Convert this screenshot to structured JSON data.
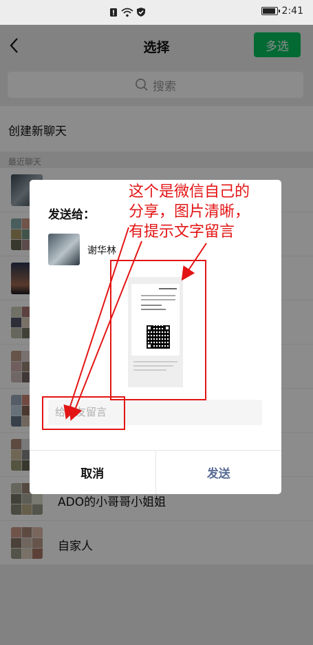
{
  "status_bar": {
    "time": "2:41"
  },
  "header": {
    "title": "选择",
    "multi_select_label": "多选"
  },
  "search": {
    "placeholder": "搜索"
  },
  "new_chat_label": "创建新聊天",
  "recent_label": "最近聊天",
  "chats": [
    {
      "name": ""
    },
    {
      "name": ""
    },
    {
      "name": ""
    },
    {
      "name": ""
    },
    {
      "name": ""
    },
    {
      "name": ""
    },
    {
      "name": ""
    },
    {
      "name": "ADO的小哥哥小姐姐"
    },
    {
      "name": "自家人"
    }
  ],
  "dialog": {
    "send_to_label": "发送给：",
    "recipient_name": "谢华林",
    "message_placeholder": "给朋友留言",
    "cancel_label": "取消",
    "send_label": "发送"
  },
  "annotation": {
    "text_line1": "这个是微信自己的",
    "text_line2": "分享，图片清晰，",
    "text_line3": "有提示文字留言"
  },
  "colors": {
    "accent_green": "#07c160",
    "send_blue": "#576b95",
    "annotation_red": "#e31414"
  }
}
